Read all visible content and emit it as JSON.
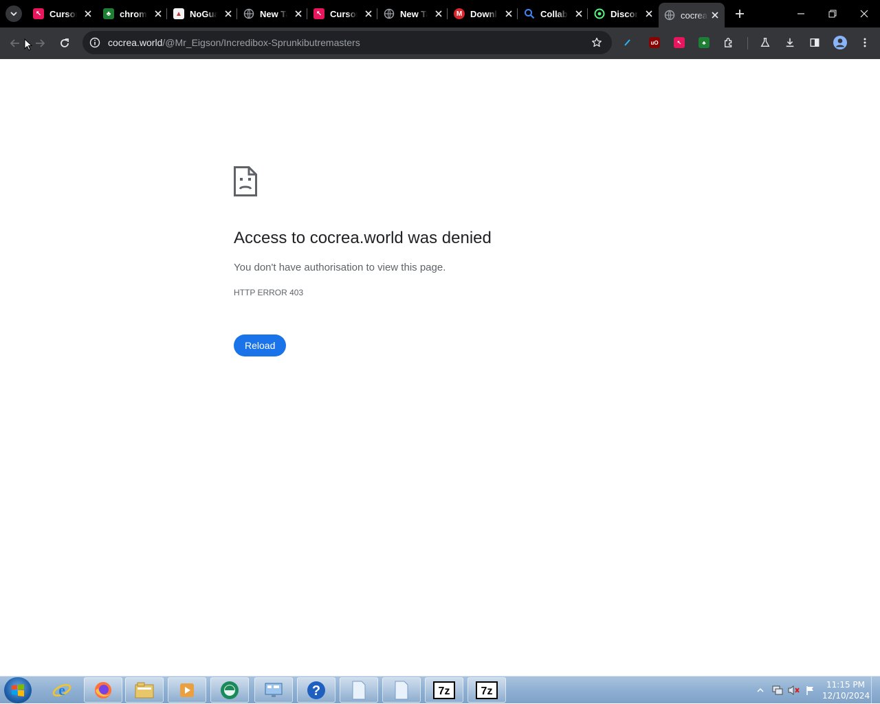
{
  "browser": {
    "tabs": [
      {
        "title": "Cursor",
        "favicon": "cursor-favicon",
        "color": "#e8175d"
      },
      {
        "title": "chrome",
        "favicon": "puzzle-favicon",
        "color": "#34a853"
      },
      {
        "title": "NoGuardian",
        "favicon": "noguardian-favicon",
        "color": "#c23b3b"
      },
      {
        "title": "New Tab",
        "favicon": "globe-favicon",
        "color": "#9aa0a6"
      },
      {
        "title": "Cursor",
        "favicon": "cursor-favicon",
        "color": "#e8175d"
      },
      {
        "title": "New Tab",
        "favicon": "globe-favicon",
        "color": "#9aa0a6"
      },
      {
        "title": "Download",
        "favicon": "mega-favicon",
        "color": "#d9272e"
      },
      {
        "title": "Collab",
        "favicon": "search-favicon",
        "color": "#4285f4"
      },
      {
        "title": "Discord",
        "favicon": "discord-favicon",
        "color": "#57f287"
      },
      {
        "title": "cocrea.world",
        "favicon": "globe-favicon",
        "color": "#9aa0a6",
        "active": true
      }
    ],
    "address": {
      "host": "cocrea.world",
      "path": "/@Mr_Eigson/Incredibox-Sprunkibutremasters"
    }
  },
  "error_page": {
    "title": "Access to cocrea.world was denied",
    "description": "You don't have authorisation to view this page.",
    "code": "HTTP ERROR 403",
    "reload_label": "Reload"
  },
  "taskbar": {
    "time": "11:15 PM",
    "date": "12/10/2024"
  },
  "colors": {
    "accent": "#1a73e8",
    "tab_strip": "#000000",
    "toolbar": "#35363a"
  }
}
